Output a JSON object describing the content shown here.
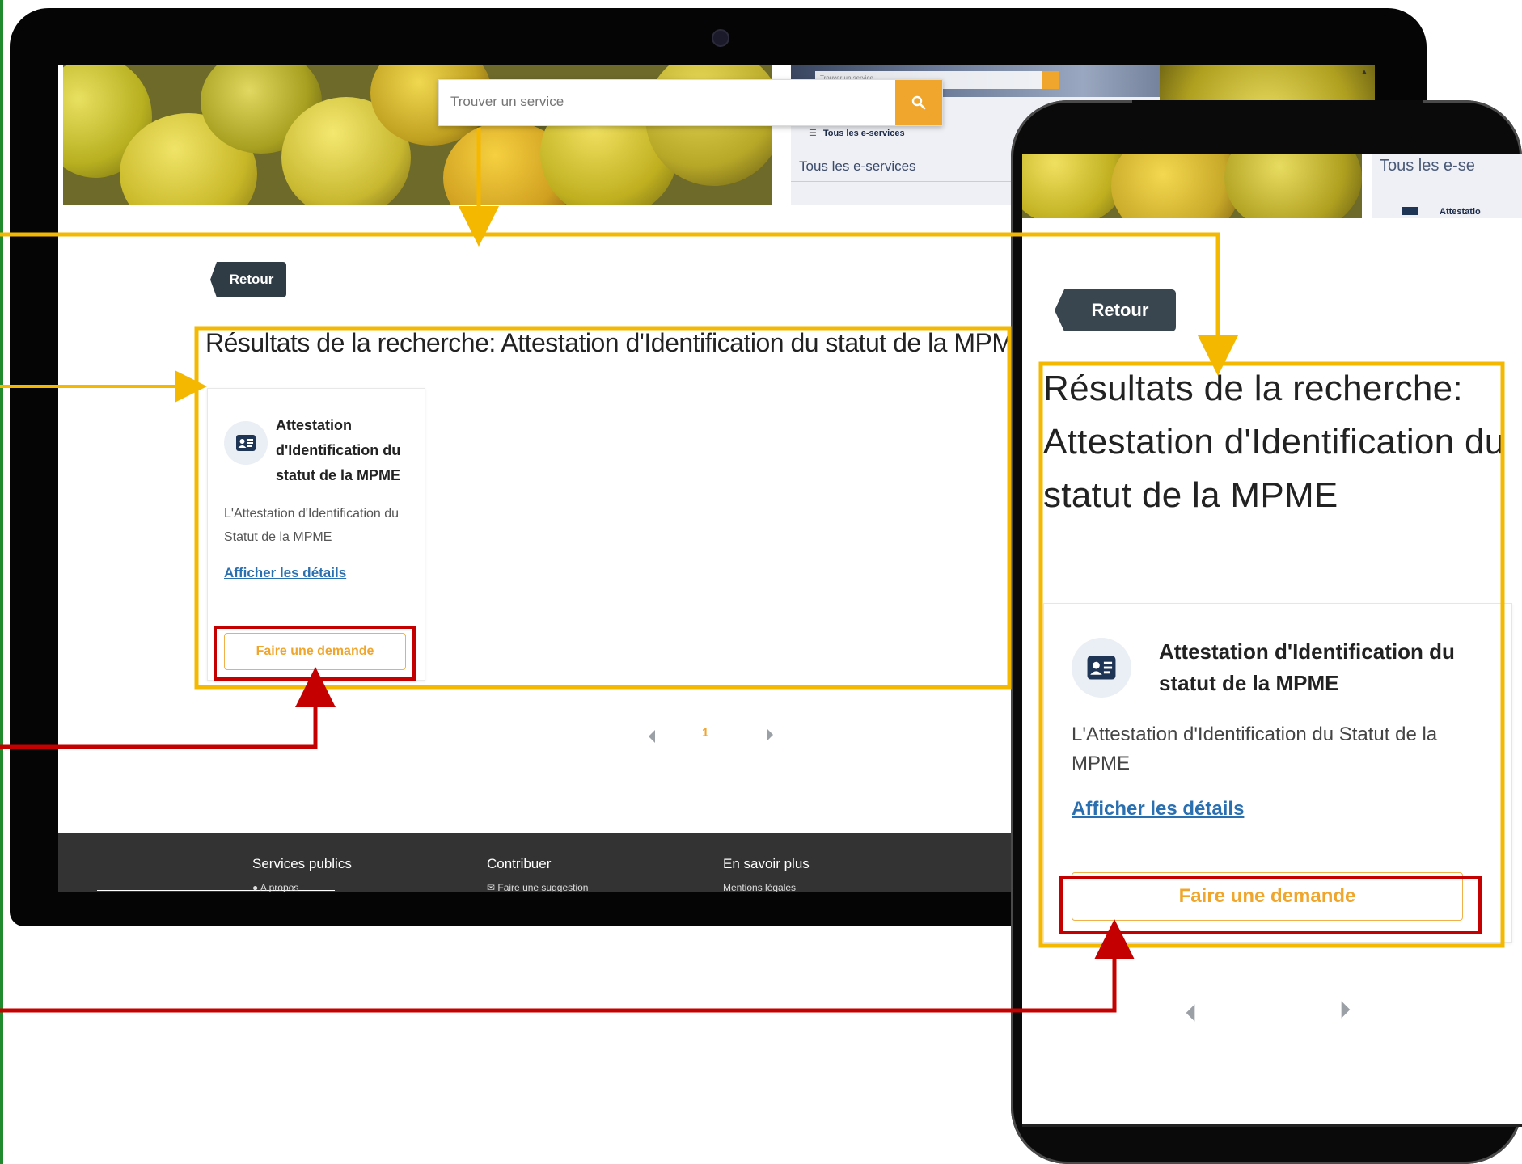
{
  "desktop": {
    "search": {
      "placeholder": "Trouver un service"
    },
    "hero_inset": {
      "search_placeholder": "Trouver un service",
      "menu_label": "Tous les e-services",
      "heading": "Tous les e-services"
    },
    "back_button": "Retour",
    "results_title": "Résultats de la recherche: Attestation d'Identification du statut de la MPME",
    "card": {
      "title": "Attestation d'Identification du statut de la MPME",
      "description": "L'Attestation d'Identification du Statut de la MPME",
      "details_link": "Afficher les détails",
      "request_button": "Faire une demande"
    },
    "pagination": {
      "current_page": "1"
    },
    "footer": {
      "columns": [
        "Services publics",
        "Contribuer",
        "En savoir plus"
      ],
      "sub_items": [
        "A propos",
        "Faire une suggestion",
        "Mentions légales"
      ]
    }
  },
  "mobile": {
    "hero_inset": {
      "heading": "Tous les e-se",
      "item": "Attestatio"
    },
    "back_button": "Retour",
    "results_title": "Résultats de la recherche: Attestation d'Identification du statut de la MPME",
    "card": {
      "title": "Attestation d'Identification du statut de la MPME",
      "description": "L'Attestation d'Identification du Statut de la MPME",
      "details_link": "Afficher les détails",
      "request_button": "Faire une demande"
    }
  },
  "colors": {
    "accent": "#f0a62c",
    "highlight_yellow": "#f5b800",
    "highlight_red": "#c40000",
    "dark_button": "#2f3b45",
    "link": "#2a6fb0",
    "footer": "#333333"
  }
}
